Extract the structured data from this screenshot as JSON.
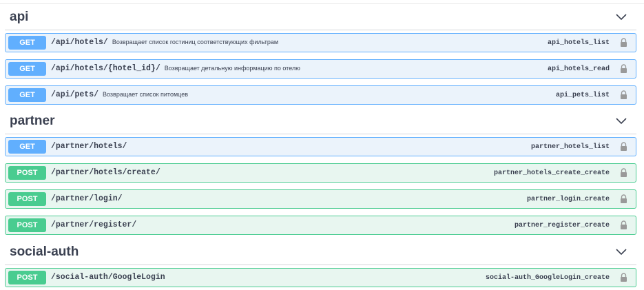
{
  "sections": [
    {
      "title": "api",
      "operations": [
        {
          "method": "GET",
          "path": "/api/hotels/",
          "description": "Возвращает список гостиниц соответствующих фильтрам",
          "operation_id": "api_hotels_list"
        },
        {
          "method": "GET",
          "path": "/api/hotels/{hotel_id}/",
          "description": "Возвращает детальную информацию по отелю",
          "operation_id": "api_hotels_read"
        },
        {
          "method": "GET",
          "path": "/api/pets/",
          "description": "Возвращает список питомцев",
          "operation_id": "api_pets_list"
        }
      ]
    },
    {
      "title": "partner",
      "operations": [
        {
          "method": "GET",
          "path": "/partner/hotels/",
          "description": "",
          "operation_id": "partner_hotels_list"
        },
        {
          "method": "POST",
          "path": "/partner/hotels/create/",
          "description": "",
          "operation_id": "partner_hotels_create_create"
        },
        {
          "method": "POST",
          "path": "/partner/login/",
          "description": "",
          "operation_id": "partner_login_create"
        },
        {
          "method": "POST",
          "path": "/partner/register/",
          "description": "",
          "operation_id": "partner_register_create"
        }
      ]
    },
    {
      "title": "social-auth",
      "operations": [
        {
          "method": "POST",
          "path": "/social-auth/GoogleLogin",
          "description": "",
          "operation_id": "social-auth_GoogleLogin_create"
        }
      ]
    }
  ],
  "colors": {
    "get": "#61affe",
    "post": "#49cc90",
    "get_bg": "#ebf3fb",
    "post_bg": "#e8f6f0",
    "text": "#3b4151"
  },
  "icons": {
    "section_toggle": "chevron-down-icon",
    "auth": "lock-icon"
  }
}
